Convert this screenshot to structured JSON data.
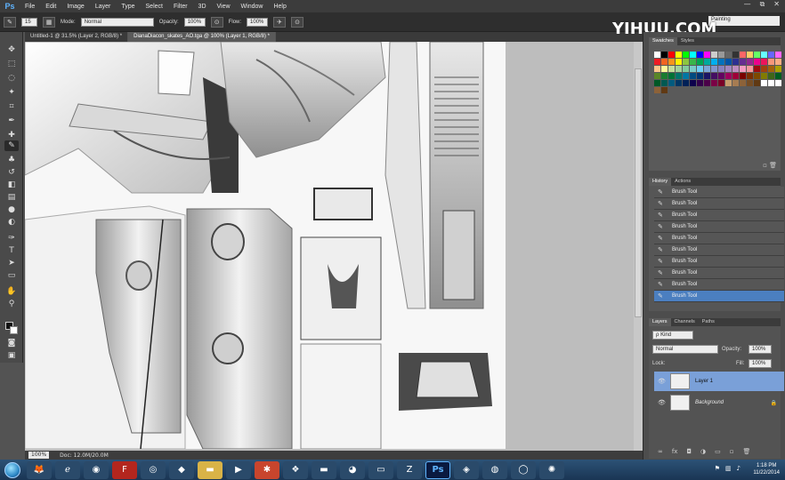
{
  "app": {
    "logo": "Ps",
    "menu": [
      "File",
      "Edit",
      "Image",
      "Layer",
      "Type",
      "Select",
      "Filter",
      "3D",
      "View",
      "Window",
      "Help"
    ],
    "window_controls": [
      "—",
      "⧉",
      "✕"
    ]
  },
  "options_bar": {
    "brush_size": "15",
    "mode_label": "Mode:",
    "mode_value": "Normal",
    "opacity_label": "Opacity:",
    "opacity_value": "100%",
    "flow_label": "Flow:",
    "flow_value": "100%",
    "workspace": "Painting"
  },
  "tabs": [
    {
      "label": "Untitled-1 @ 31.5% (Layer 2, RGB/8) *",
      "active": false
    },
    {
      "label": "DianaDiacon_skates_AO.tga @ 100% (Layer 1, RGB/8) *",
      "active": true
    }
  ],
  "watermark": "YIHUU.COM",
  "status": {
    "zoom": "100%",
    "doc": "Doc: 12.0M/20.0M"
  },
  "swatches_panel": {
    "tabs": [
      "Swatches",
      "Styles"
    ],
    "colors": [
      "#ffffff",
      "#000000",
      "#ff0000",
      "#ffff00",
      "#00ff00",
      "#00ffff",
      "#0000ff",
      "#ff00ff",
      "#cccccc",
      "#999999",
      "#666666",
      "#333333",
      "#ff6666",
      "#ffcc66",
      "#66ff66",
      "#66ffff",
      "#6666ff",
      "#ff66ff",
      "#ed1c24",
      "#f26522",
      "#f7941d",
      "#fff200",
      "#8dc63f",
      "#39b54a",
      "#00a651",
      "#00a99d",
      "#00aeef",
      "#0072bc",
      "#0054a6",
      "#2e3192",
      "#662d91",
      "#92278f",
      "#ec008c",
      "#ed145b",
      "#f7977a",
      "#fbad82",
      "#fdc68c",
      "#fff79a",
      "#c4df9b",
      "#a3d39c",
      "#82ca9c",
      "#7accc8",
      "#6dcff6",
      "#7da7d8",
      "#8393ca",
      "#8781bd",
      "#a186be",
      "#bd8cbf",
      "#f49ac1",
      "#f5989d",
      "#9e0b0f",
      "#a0410d",
      "#a3620a",
      "#aba000",
      "#598527",
      "#1a7b30",
      "#007236",
      "#00746b",
      "#0076a3",
      "#004b80",
      "#003471",
      "#1b1464",
      "#440e62",
      "#630460",
      "#9e005d",
      "#9e0039",
      "#790000",
      "#7b2e00",
      "#7d4900",
      "#827b00",
      "#406618",
      "#005e20",
      "#005826",
      "#005952",
      "#005b7f",
      "#003663",
      "#002157",
      "#0d004c",
      "#32004b",
      "#4b0049",
      "#7b0046",
      "#7a0026",
      "#c69c6d",
      "#a67c52",
      "#8c6239",
      "#754c24",
      "#603913",
      "#ffffff",
      "#ffffff",
      "#ffffff",
      "#8c6239",
      "#603913"
    ]
  },
  "history_panel": {
    "tabs": [
      "History",
      "Actions"
    ],
    "items": [
      "Brush Tool",
      "Brush Tool",
      "Brush Tool",
      "Brush Tool",
      "Brush Tool",
      "Brush Tool",
      "Brush Tool",
      "Brush Tool",
      "Brush Tool",
      "Brush Tool"
    ]
  },
  "layers_panel": {
    "tabs": [
      "Layers",
      "Channels",
      "Paths"
    ],
    "kind_label": "ρ Kind",
    "blend_mode": "Normal",
    "opacity_label": "Opacity:",
    "opacity_value": "100%",
    "lock_label": "Lock:",
    "fill_label": "Fill:",
    "fill_value": "100%",
    "layers": [
      {
        "name": "Layer 1",
        "active": true
      },
      {
        "name": "Background",
        "active": false
      }
    ]
  },
  "taskbar": {
    "time": "1:18 PM",
    "date": "11/22/2014"
  }
}
